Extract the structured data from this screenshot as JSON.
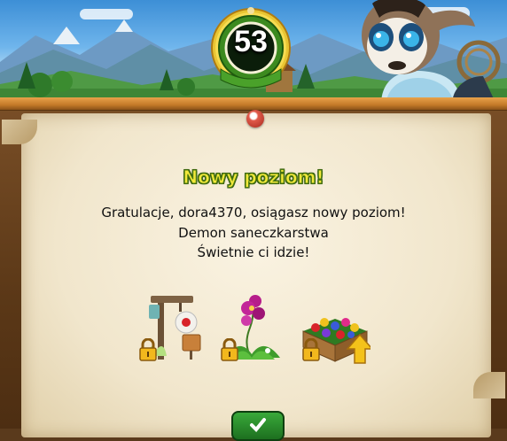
{
  "level": {
    "number": "53"
  },
  "dialog": {
    "title": "Nowy poziom!",
    "lines": [
      "Gratulacje, dora4370, osiągasz nowy poziom!",
      "Demon saneczkarstwa",
      "Świetnie ci idzie!"
    ]
  },
  "rewards": [
    {
      "icon": "signpost-decoration-icon",
      "locked": true
    },
    {
      "icon": "orchid-plant-icon",
      "locked": true
    },
    {
      "icon": "flower-bed-upgrade-icon",
      "locked": true
    }
  ],
  "colors": {
    "title_fill": "#f2e83a",
    "title_outline": "#3d6b0c",
    "button_green": "#2e8f2f"
  }
}
